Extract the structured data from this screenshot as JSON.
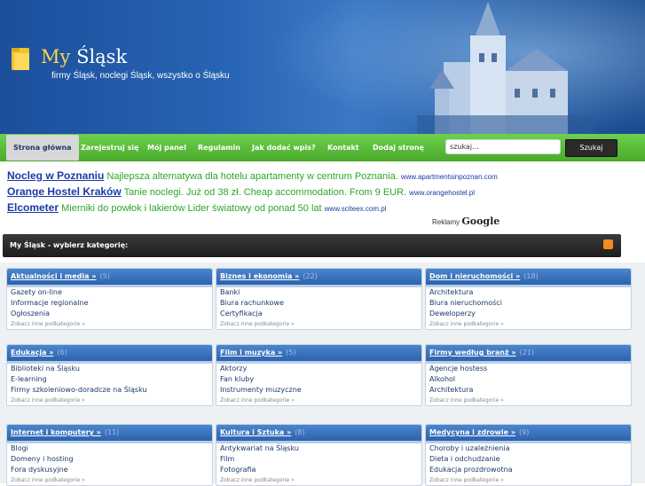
{
  "header": {
    "title_my": "My",
    "title_rest": "Śląsk",
    "tagline": "firmy Śląsk, noclegi Śląsk, wszystko o Śląsku"
  },
  "nav": {
    "items": [
      {
        "label": "Strona główna"
      },
      {
        "label": "Zarejestruj się"
      },
      {
        "label": "Mój panel"
      },
      {
        "label": "Regulamin"
      },
      {
        "label": "Jak dodać wpis?"
      },
      {
        "label": "Kontakt"
      },
      {
        "label": "Dodaj stronę"
      }
    ],
    "search_value": "szukaj...",
    "search_button": "Szukaj"
  },
  "ads": [
    {
      "title": "Nocleg w Poznaniu",
      "text": "Najlepsza alternatywa dla hotelu apartamenty w centrum Poznania.",
      "url": "www.apartmentsinpoznan.com"
    },
    {
      "title": "Orange Hostel Kraków",
      "text": "Tanie noclegi. Już od 38 zł. Cheap accommodation. From 9 EUR.",
      "url": "www.orangehostel.pl"
    },
    {
      "title": "Elcometer",
      "text": "Mierniki do powłok i lakierów Lider światowy od ponad 50 lat",
      "url": "www.sciteex.com.pl"
    }
  ],
  "ads_by": {
    "label": "Reklamy",
    "brand": "Google"
  },
  "category_bar": {
    "title": "My Śląsk - wybierz kategorię:",
    "rss_icon": "rss-icon"
  },
  "categories": [
    {
      "title": "Aktualności i media »",
      "count": "(5)",
      "links": [
        "Gazety on-line",
        "Informacje regionalne",
        "Ogłoszenia"
      ],
      "more": "Zobacz inne podkategorie »"
    },
    {
      "title": "Biznes i ekonomia »",
      "count": "(22)",
      "links": [
        "Banki",
        "Biura rachunkowe",
        "Certyfikacja"
      ],
      "more": "Zobacz inne podkategorie »"
    },
    {
      "title": "Dom i nieruchomości »",
      "count": "(18)",
      "links": [
        "Architektura",
        "Biura nieruchomości",
        "Deweloperzy"
      ],
      "more": "Zobacz inne podkategorie »"
    },
    {
      "title": "Edukacja »",
      "count": "(6)",
      "links": [
        "Biblioteki na Śląsku",
        "E-learning",
        "Firmy szkoleniowo-doradcze na Śląsku"
      ],
      "more": "Zobacz inne podkategorie »"
    },
    {
      "title": "Film i muzyka »",
      "count": "(5)",
      "links": [
        "Aktorzy",
        "Fan kluby",
        "Instrumenty muzyczne"
      ],
      "more": "Zobacz inne podkategorie »"
    },
    {
      "title": "Firmy według branż »",
      "count": "(21)",
      "links": [
        "Agencje hostess",
        "Alkohol",
        "Architektura"
      ],
      "more": "Zobacz inne podkategorie »"
    },
    {
      "title": "Internet i komputery »",
      "count": "(11)",
      "links": [
        "Blogi",
        "Domeny i hosting",
        "Fora dyskusyjne"
      ],
      "more": "Zobacz inne podkategorie »"
    },
    {
      "title": "Kultura i Sztuka »",
      "count": "(8)",
      "links": [
        "Antykwariat na Śląsku",
        "Film",
        "Fotografia"
      ],
      "more": "Zobacz inne podkategorie »"
    },
    {
      "title": "Medycyna i zdrowie »",
      "count": "(9)",
      "links": [
        "Choroby i uzależnienia",
        "Dieta i odchudzanie",
        "Edukacja prozdrowotna"
      ],
      "more": "Zobacz inne podkategorie »"
    }
  ]
}
